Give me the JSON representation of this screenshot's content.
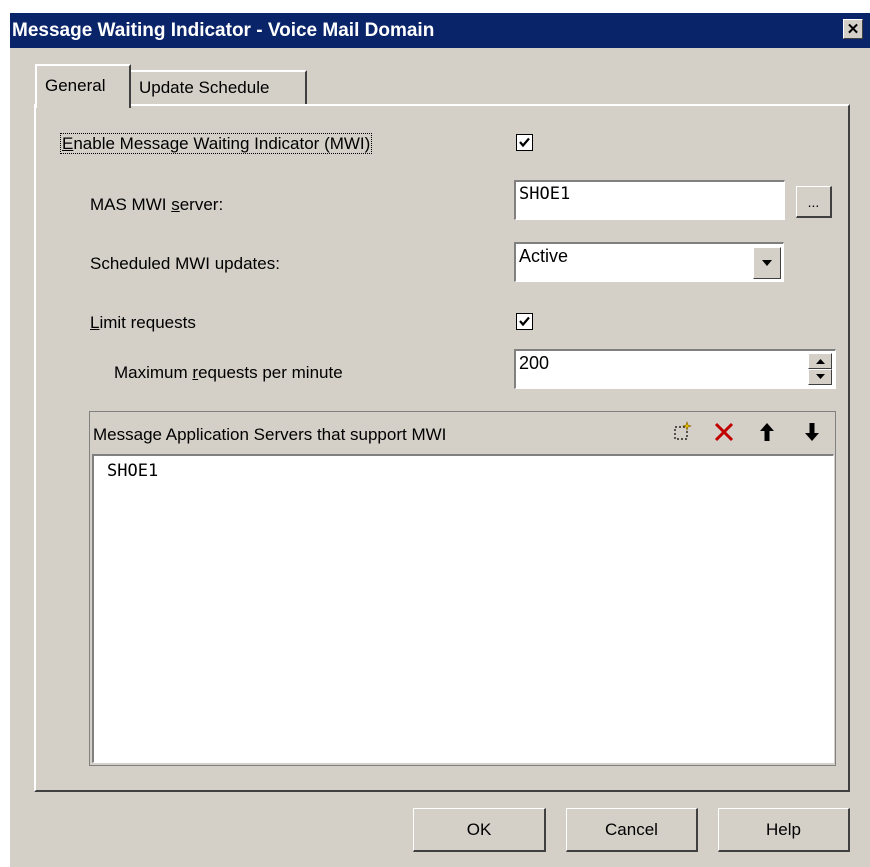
{
  "window": {
    "title": "Message Waiting Indicator - Voice Mail Domain",
    "close_glyph": "✕"
  },
  "tabs": [
    {
      "label": "General",
      "active": true
    },
    {
      "label": "Update Schedule",
      "active": false
    }
  ],
  "enable_mwi": {
    "label_accel": "E",
    "label_rest": "nable Message Waiting Indicator (MWI)",
    "checked": true
  },
  "mas_server": {
    "label_pre": "MAS MWI ",
    "label_accel": "s",
    "label_rest": "erver:",
    "value": "SHOE1",
    "browse_label": "..."
  },
  "scheduled": {
    "label": "Scheduled MWI updates:",
    "value": "Active"
  },
  "limit": {
    "label_accel": "L",
    "label_rest": "imit requests",
    "checked": true
  },
  "max_requests": {
    "label_pre": "Maximum ",
    "label_accel": "r",
    "label_rest": "equests per minute",
    "value": "200"
  },
  "servers_list": {
    "header": "Message Application Servers that support MWI",
    "toolbar": [
      "new-icon",
      "delete-icon",
      "move-up-icon",
      "move-down-icon"
    ],
    "items": [
      "SHOE1"
    ]
  },
  "buttons": {
    "ok": "OK",
    "cancel": "Cancel",
    "help": "Help"
  },
  "colors": {
    "titlebar": "#0a246a",
    "face": "#d4d0c8",
    "delete": "#c00000"
  }
}
